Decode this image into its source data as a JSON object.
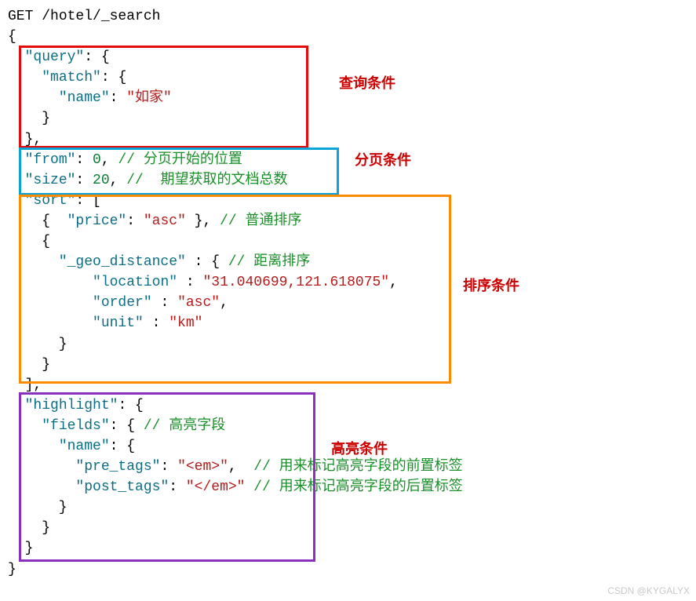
{
  "code": {
    "method": "GET",
    "path": "/hotel/_search",
    "query_key": "\"query\"",
    "match_key": "\"match\"",
    "name_key": "\"name\"",
    "name_val": "\"如家\"",
    "from_key": "\"from\"",
    "from_val": "0",
    "from_comment": "// 分页开始的位置",
    "size_key": "\"size\"",
    "size_val": "20",
    "size_comment": "//  期望获取的文档总数",
    "sort_key": "\"sort\"",
    "price_key": "\"price\"",
    "price_val": "\"asc\"",
    "price_comment": "// 普通排序",
    "geo_key": "\"_geo_distance\"",
    "geo_comment": "// 距离排序",
    "location_key": "\"location\"",
    "location_val": "\"31.040699,121.618075\"",
    "order_key": "\"order\"",
    "order_val": "\"asc\"",
    "unit_key": "\"unit\"",
    "unit_val": "\"km\"",
    "highlight_key": "\"highlight\"",
    "fields_key": "\"fields\"",
    "fields_comment": "// 高亮字段",
    "hname_key": "\"name\"",
    "pre_key": "\"pre_tags\"",
    "pre_val": "\"<em>\"",
    "pre_comment": "// 用来标记高亮字段的前置标签",
    "post_key": "\"post_tags\"",
    "post_val": "\"</em>\"",
    "post_comment": "// 用来标记高亮字段的后置标签"
  },
  "labels": {
    "query": "查询条件",
    "paging": "分页条件",
    "sort": "排序条件",
    "highlight": "高亮条件"
  },
  "watermark": "CSDN @KYGALYX"
}
